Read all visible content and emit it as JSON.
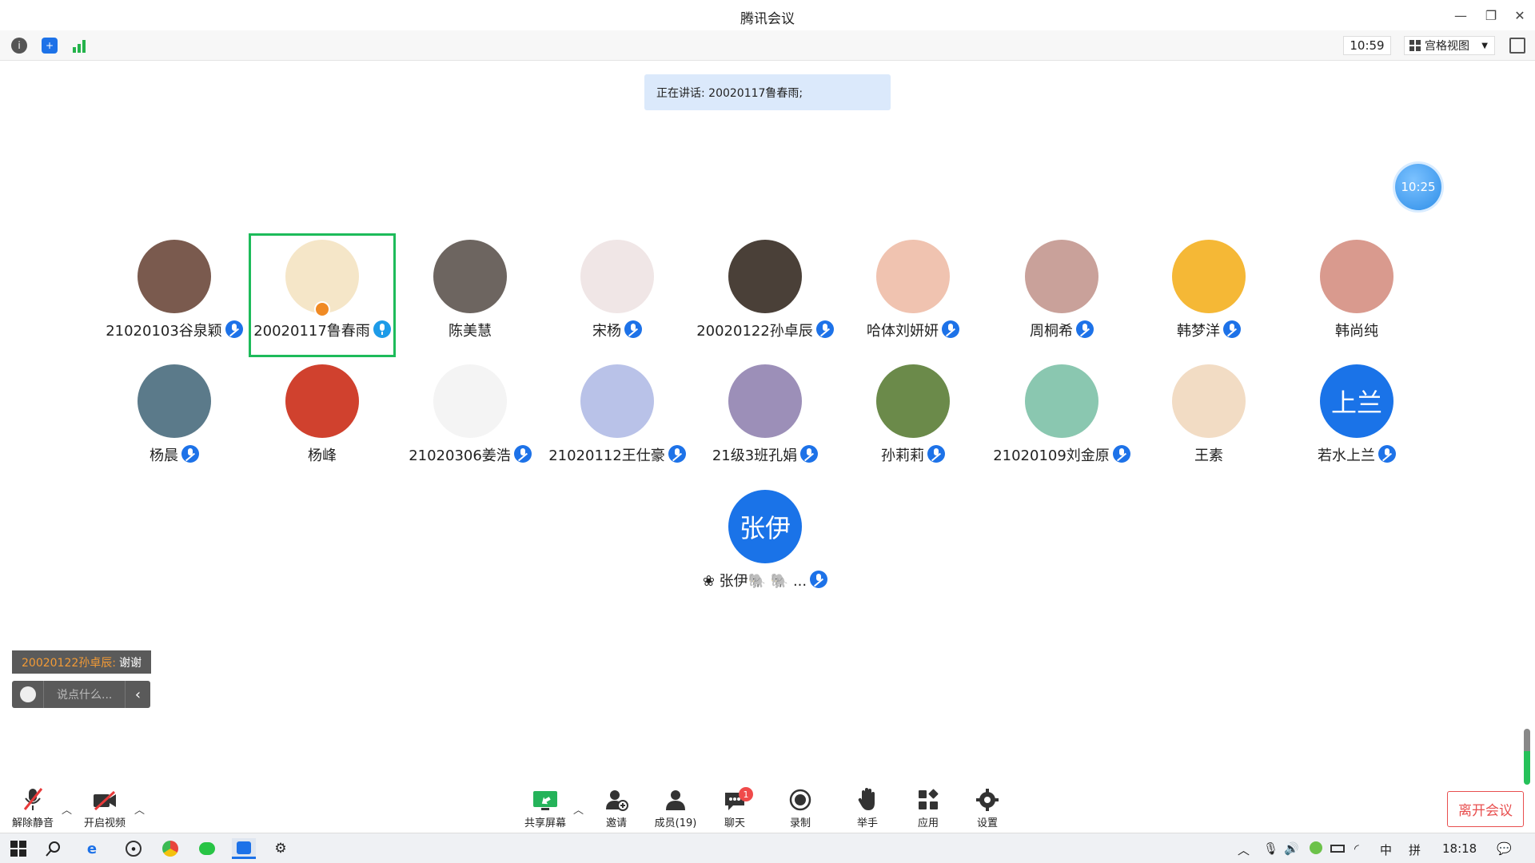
{
  "window": {
    "title": "腾讯会议"
  },
  "toolbar": {
    "meeting_clock": "10:59",
    "view_mode": "宫格视图"
  },
  "speaking_banner": "正在讲话: 20020117鲁春雨;",
  "floating_timer": "10:25",
  "participants": [
    {
      "name": "21020103谷泉颖",
      "mic": "muted",
      "avatar_color": "#7a5a4e"
    },
    {
      "name": "20020117鲁春雨",
      "mic": "on",
      "avatar_color": "#f5e6c8",
      "active": true
    },
    {
      "name": "陈美慧",
      "mic": "none",
      "avatar_color": "#6d6560"
    },
    {
      "name": "宋杨",
      "mic": "muted",
      "avatar_color": "#f0e6e6"
    },
    {
      "name": "20020122孙卓辰",
      "mic": "muted",
      "avatar_color": "#4a4038"
    },
    {
      "name": "哈体刘妍妍",
      "mic": "muted",
      "avatar_color": "#f0c3b0"
    },
    {
      "name": "周桐希",
      "mic": "muted",
      "avatar_color": "#c9a19a"
    },
    {
      "name": "韩梦洋",
      "mic": "muted",
      "avatar_color": "#f5b836"
    },
    {
      "name": "韩尚纯",
      "mic": "none",
      "avatar_color": "#d99a8e"
    },
    {
      "name": "杨晨",
      "mic": "muted",
      "avatar_color": "#5b7a8a"
    },
    {
      "name": "杨峰",
      "mic": "none",
      "avatar_color": "#d0412e"
    },
    {
      "name": "21020306姜浩",
      "mic": "muted",
      "avatar_color": "#f4f4f4"
    },
    {
      "name": "21020112王仕豪",
      "mic": "muted",
      "avatar_color": "#b9c2e8"
    },
    {
      "name": "21级3班孔娟",
      "mic": "muted",
      "avatar_color": "#9c8fb8"
    },
    {
      "name": "孙莉莉",
      "mic": "muted",
      "avatar_color": "#6b8a4a"
    },
    {
      "name": "21020109刘金原",
      "mic": "muted",
      "avatar_color": "#8ac7b0"
    },
    {
      "name": "王素",
      "mic": "none",
      "avatar_color": "#f2dcc4"
    },
    {
      "name": "若水上兰",
      "mic": "muted",
      "avatar_color": "#1a73e8",
      "initials": "上兰"
    },
    {
      "name": "❀ 张伊🐘 🐘 ...",
      "mic": "muted",
      "avatar_color": "#1a73e8",
      "initials": "张伊"
    }
  ],
  "chat": {
    "last_sender": "20020122孙卓辰:",
    "last_message": "谢谢",
    "input_placeholder": "说点什么..."
  },
  "controls": {
    "unmute": "解除静音",
    "start_video": "开启视频",
    "share_screen": "共享屏幕",
    "invite": "邀请",
    "members": "成员(19)",
    "chat": "聊天",
    "chat_badge": "1",
    "record": "录制",
    "raise_hand": "举手",
    "apps": "应用",
    "settings": "设置",
    "leave": "离开会议"
  },
  "taskbar": {
    "time": "18:18",
    "ime_lang": "中",
    "ime_mode": "拼"
  }
}
